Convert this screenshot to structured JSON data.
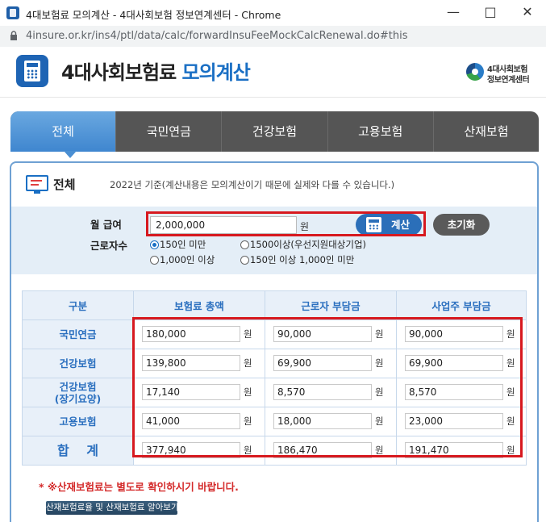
{
  "window": {
    "title": "4대보험료 모의계산 - 4대사회보험 정보연계센터 - Chrome",
    "url": "4insure.or.kr/ins4/ptl/data/calc/forwardInsuFeeMockCalcRenewal.do#this"
  },
  "header": {
    "title_main": "4대사회보험료 ",
    "title_accent": "모의계산",
    "org_line1": "4대사회보험",
    "org_line2": "정보연계센터"
  },
  "tabs": [
    {
      "label": "전체",
      "active": true
    },
    {
      "label": "국민연금",
      "active": false
    },
    {
      "label": "건강보험",
      "active": false
    },
    {
      "label": "고용보험",
      "active": false
    },
    {
      "label": "산재보험",
      "active": false
    }
  ],
  "section": {
    "title": "전체",
    "note": "2022년 기준(계산내용은 모의계산이기 때문에 실제와 다를 수 있습니다.)"
  },
  "form": {
    "salary_label": "월 급여",
    "salary_value": "2,000,000",
    "salary_unit": "원",
    "calc_label": "계산",
    "reset_label": "초기화",
    "workers_label": "근로자수",
    "worker_options": [
      {
        "label": "150인 미만",
        "selected": true
      },
      {
        "label": "1500이상(우선지원대상기업)",
        "selected": false
      },
      {
        "label": "1,000인 이상",
        "selected": false
      },
      {
        "label": "150인 이상 1,000인 미만",
        "selected": false
      }
    ]
  },
  "table": {
    "headers": [
      "구분",
      "보험료 총액",
      "근로자 부담금",
      "사업주 부담금"
    ],
    "unit": "원",
    "rows": [
      {
        "label": "국민연금",
        "total": "180,000",
        "employee": "90,000",
        "employer": "90,000"
      },
      {
        "label": "건강보험",
        "total": "139,800",
        "employee": "69,900",
        "employer": "69,900"
      },
      {
        "label": "건강보험\n(장기요양)",
        "total": "17,140",
        "employee": "8,570",
        "employer": "8,570"
      },
      {
        "label": "고용보험",
        "total": "41,000",
        "employee": "18,000",
        "employer": "23,000"
      },
      {
        "label": "합   계",
        "total": "377,940",
        "employee": "186,470",
        "employer": "191,470"
      }
    ]
  },
  "footer": {
    "notice": "* ※산재보험료는 별도로 확인하시기 바랍니다.",
    "link_label": "산재보험료율 및 산재보험료 알아보기"
  },
  "colors": {
    "accent": "#1a6fc4",
    "highlight": "#d7191f",
    "tab_bar": "#555555",
    "tab_active": "#4a8fd3"
  }
}
